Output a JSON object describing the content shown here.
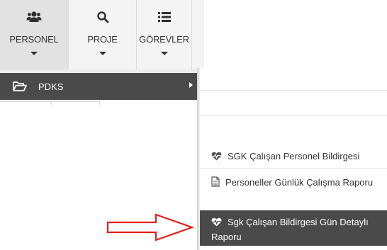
{
  "toolbar": {
    "buttons": [
      {
        "label": "PERSONEL",
        "icon": "users-icon",
        "active": true
      },
      {
        "label": "PROJE",
        "icon": "search-icon",
        "active": false
      },
      {
        "label": "GÖREVLER",
        "icon": "list-icon",
        "active": false
      }
    ]
  },
  "submenu": {
    "pdks_label": "PDKS",
    "icon": "folder-open-icon"
  },
  "flyout": {
    "items": [
      {
        "label": "SGK Çalışan Personel Bildirgesi",
        "icon": "heartbeat-icon"
      },
      {
        "label": "Personeller Günlük Çalışma Raporu",
        "icon": "document-icon"
      },
      {
        "label": "Sgk Çalışan Bildirgesi Gün Detaylı Raporu",
        "icon": "heartbeat-icon",
        "highlighted": true
      }
    ]
  },
  "colors": {
    "menu_dark": "#4a4a4a",
    "toolbar_bg": "#f4f4f4",
    "active_bg": "#e2e2e2",
    "annotation_arrow": "#e0201a"
  }
}
